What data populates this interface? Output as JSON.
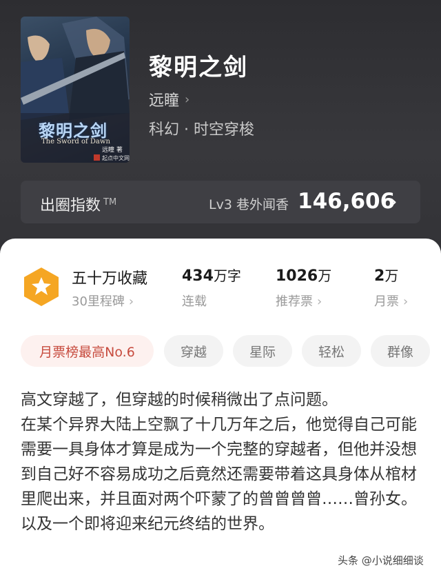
{
  "book": {
    "title": "黎明之剑",
    "author": "远瞳",
    "genre": "科幻 · 时空穿梭",
    "cover": {
      "title": "黎明之剑",
      "subtitle": "The Sword of Dawn",
      "author_mark": "远瞳 著",
      "publisher": "起点中文网"
    }
  },
  "index_bar": {
    "label": "出圈指数",
    "trademark": "TM",
    "level": "Lv3 巷外闻香",
    "value": "146,606"
  },
  "stats": {
    "badge_title": "五十万收藏",
    "badge_sub": "30里程碑",
    "words_value": "434",
    "words_unit": "万字",
    "words_status": "连载",
    "rec_value": "1026",
    "rec_unit": "万",
    "rec_label": "推荐票",
    "monthly_value": "2",
    "monthly_unit": "万",
    "monthly_label": "月票"
  },
  "tags": [
    "月票榜最高No.6",
    "穿越",
    "星际",
    "轻松",
    "群像"
  ],
  "description": [
    "高文穿越了，但穿越的时候稍微出了点问题。",
    "在某个异界大陆上空飘了十几万年之后，他觉得自己可能需要一具身体才算是成为一个完整的穿越者，但他并没想到自己好不容易成功之后竟然还需要带着这具身体从棺材里爬出来，并且面对两个吓蒙了的曾曾曾曾……曾孙女。",
    "以及一个即将迎来纪元终结的世界。"
  ],
  "watermark": "头条 @小说细细谈",
  "colors": {
    "header_bg": "#2d2d31",
    "accent_red": "#c74b3e",
    "badge_orange": "#f5a623"
  }
}
